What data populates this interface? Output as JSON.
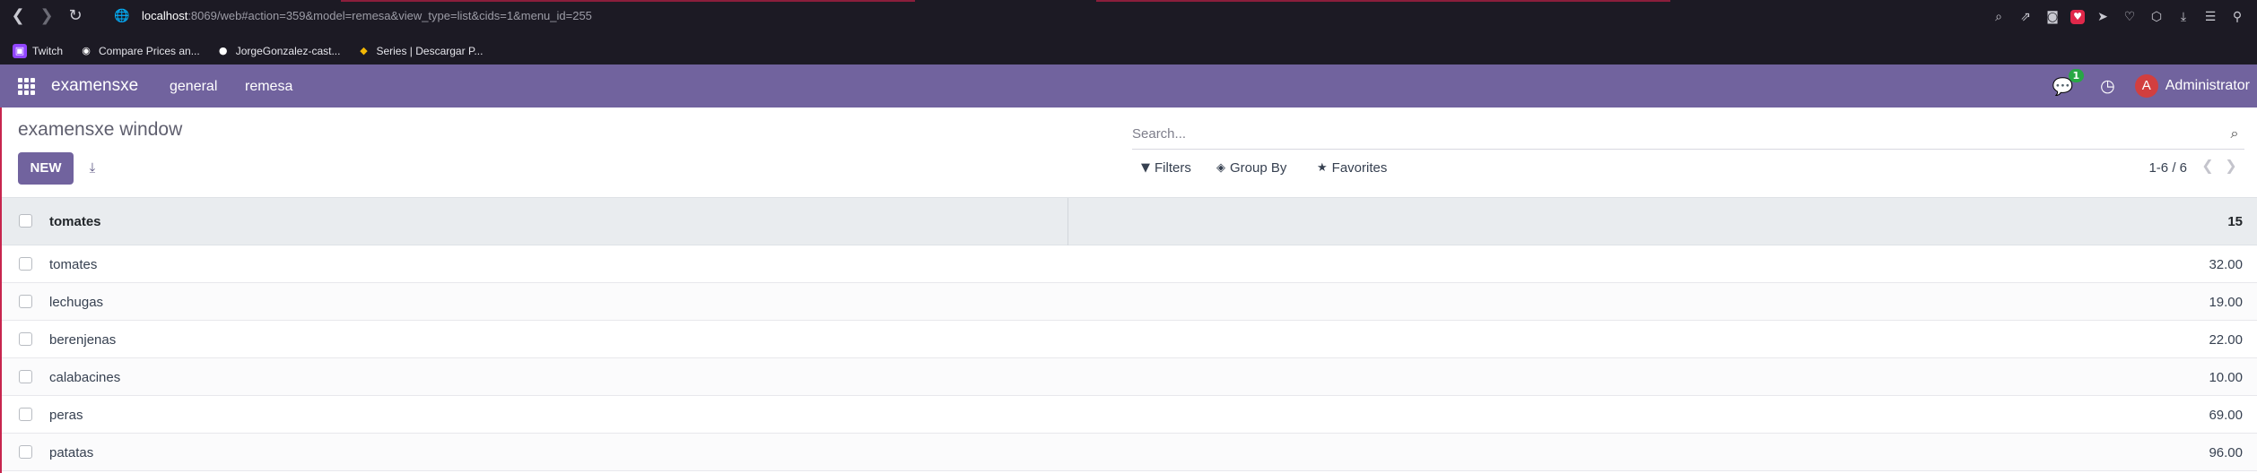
{
  "browser": {
    "back_glyph": "❮",
    "forward_glyph": "❯",
    "reload_glyph": "↻",
    "globe_glyph": "🌐",
    "url_host": "localhost",
    "url_rest": ":8069/web#action=359&model=remesa&view_type=list&cids=1&menu_id=255",
    "ext_icons": [
      "zoom-icon",
      "share-icon",
      "camera-icon",
      "pocket-icon",
      "send-icon",
      "heart-icon",
      "box-icon",
      "download-icon",
      "menu-icon",
      "profile-icon"
    ]
  },
  "bookmarks": [
    {
      "label": "Twitch",
      "icon": "twitch-icon"
    },
    {
      "label": "Compare Prices an...",
      "icon": "compare-icon"
    },
    {
      "label": "JorgeGonzalez-cast...",
      "icon": "github-icon"
    },
    {
      "label": "Series | Descargar P...",
      "icon": "series-icon"
    }
  ],
  "navbar": {
    "brand": "examensxe",
    "menu": [
      "general",
      "remesa"
    ],
    "chat_badge": "1",
    "avatar_letter": "A",
    "user_name": "Administrator",
    "color": "#71639e"
  },
  "control": {
    "breadcrumb": "examensxe window",
    "new_label": "NEW",
    "search_placeholder": "Search...",
    "filters_label": "Filters",
    "group_by_label": "Group By",
    "favorites_label": "Favorites",
    "pager": "1-6 / 6"
  },
  "list": {
    "header_name": "tomates",
    "header_total": "15",
    "rows": [
      {
        "name": "tomates",
        "qty": "32.00"
      },
      {
        "name": "lechugas",
        "qty": "19.00"
      },
      {
        "name": "berenjenas",
        "qty": "22.00"
      },
      {
        "name": "calabacines",
        "qty": "10.00"
      },
      {
        "name": "peras",
        "qty": "69.00"
      },
      {
        "name": "patatas",
        "qty": "96.00"
      }
    ]
  }
}
